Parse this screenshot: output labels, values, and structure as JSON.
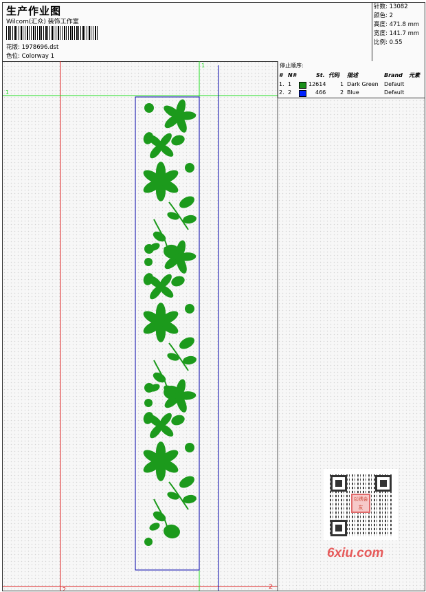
{
  "header": {
    "title": "生产作业图",
    "company": "Wilcom(汇众) 装饰工作室",
    "design_file": "花版:  1978696.dst",
    "colorway": "色位:  Colorway 1"
  },
  "stats": [
    "针数: 13082",
    "颜色: 2",
    "高度: 471.8 mm",
    "宽度: 141.7 mm",
    "比例: 0.55"
  ],
  "stop_sequence": {
    "title": "停止顺序:",
    "columns": [
      "#",
      "N#",
      "St.",
      "代码",
      "描述",
      "Brand",
      "元素"
    ],
    "rows": [
      {
        "idx": "1.",
        "n": "1",
        "color": "#1a8f1a",
        "stitches": "12614",
        "code": "1",
        "desc": "Dark Green",
        "brand": "Default"
      },
      {
        "idx": "2.",
        "n": "2",
        "color": "#0022ff",
        "stitches": "466",
        "code": "2",
        "desc": "Blue",
        "brand": "Default"
      }
    ]
  },
  "guides": {
    "green_label_top": "1",
    "green_label_left": "1",
    "red_label_bottom": "2",
    "red_label_right": "2"
  },
  "colors": {
    "guide_green": "#22dd22",
    "guide_red": "#dd2222",
    "outline_blue": "#0000aa",
    "embroidery_green": "#1c9a1c"
  },
  "watermark": "6xiu.com",
  "seal_text": "以绣会友"
}
